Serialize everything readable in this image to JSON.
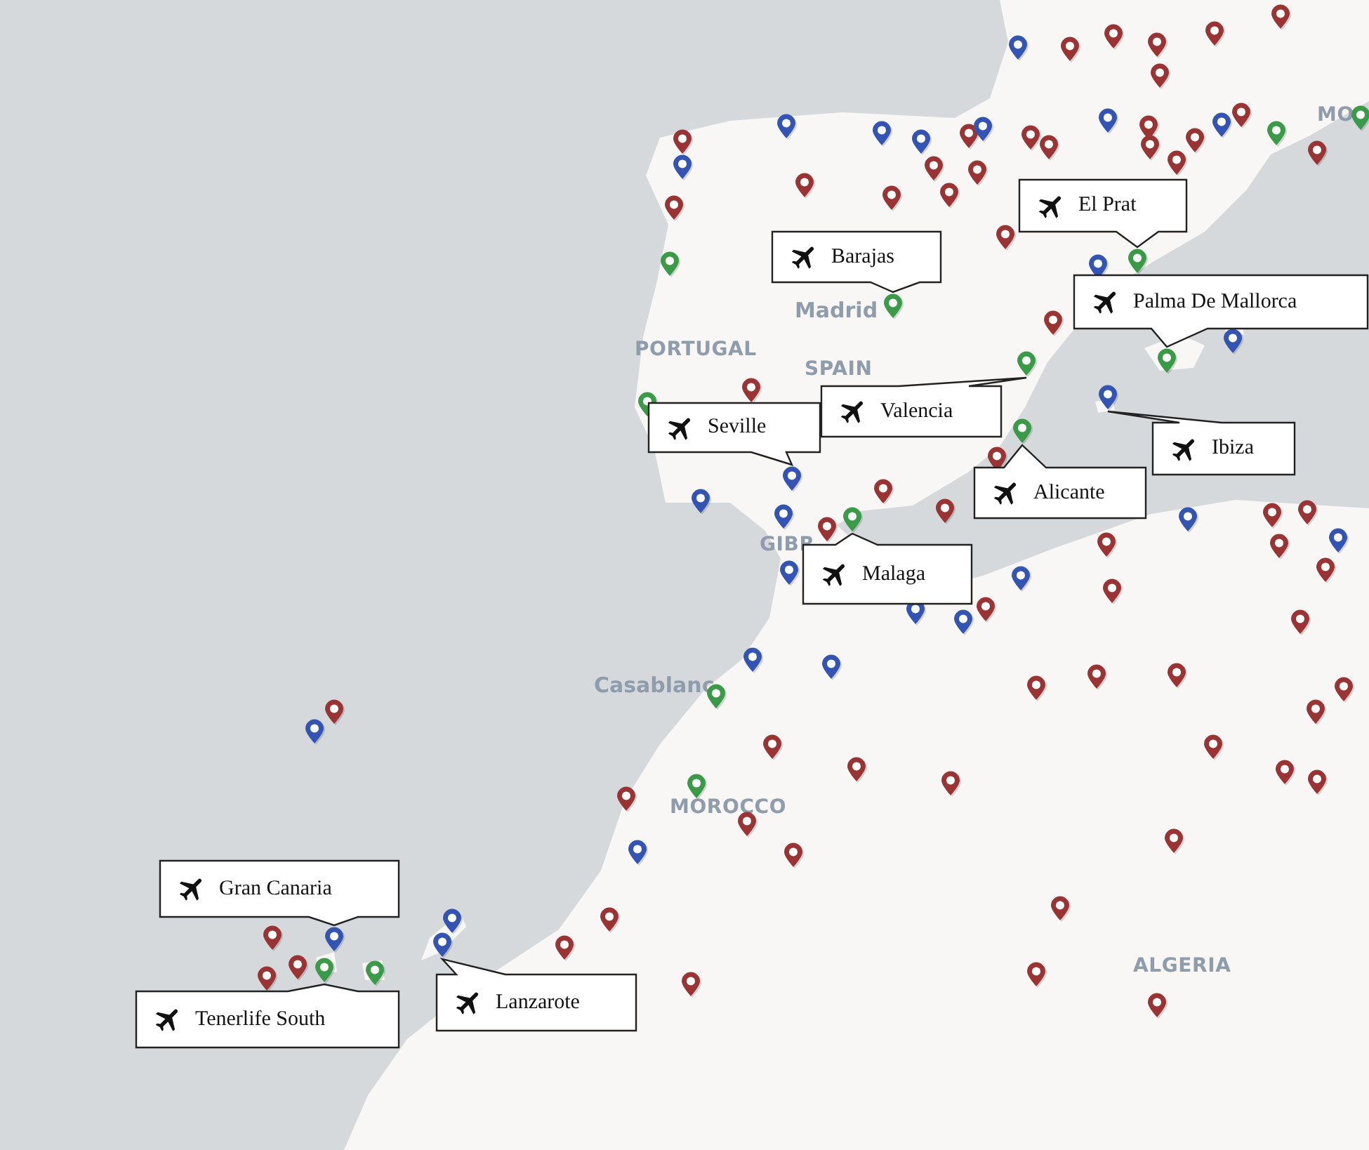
{
  "map": {
    "place_labels": [
      {
        "text": "MO",
        "kind": "country"
      },
      {
        "text": "Madrid",
        "kind": "city"
      },
      {
        "text": "PORTUGAL",
        "kind": "country"
      },
      {
        "text": "SPAIN",
        "kind": "country"
      },
      {
        "text": "GIBR",
        "kind": "country"
      },
      {
        "text": "Casablanc",
        "kind": "city"
      },
      {
        "text": "MOROCCO",
        "kind": "country"
      },
      {
        "text": "ALGERIA",
        "kind": "country"
      }
    ],
    "pins": [
      {
        "color": "#3454b4"
      },
      {
        "color": "#9a3434"
      },
      {
        "color": "#9a3434"
      },
      {
        "color": "#9a3434"
      },
      {
        "color": "#9a3434"
      },
      {
        "color": "#9a3434"
      },
      {
        "color": "#9a3434"
      },
      {
        "color": "#3454b4"
      },
      {
        "color": "#3454b4"
      },
      {
        "color": "#3454b4"
      },
      {
        "color": "#9a3434"
      },
      {
        "color": "#3454b4"
      },
      {
        "color": "#9a3434"
      },
      {
        "color": "#9a3434"
      },
      {
        "color": "#3454b4"
      },
      {
        "color": "#9a3434"
      },
      {
        "color": "#9a3434"
      },
      {
        "color": "#9a3434"
      },
      {
        "color": "#3454b4"
      },
      {
        "color": "#9a3434"
      },
      {
        "color": "#3a9a48"
      },
      {
        "color": "#3a9a48"
      },
      {
        "color": "#9a3434"
      },
      {
        "color": "#9a3434"
      },
      {
        "color": "#3454b4"
      },
      {
        "color": "#9a3434"
      },
      {
        "color": "#9a3434"
      },
      {
        "color": "#9a3434"
      },
      {
        "color": "#9a3434"
      },
      {
        "color": "#9a3434"
      },
      {
        "color": "#9a3434"
      },
      {
        "color": "#9a3434"
      },
      {
        "color": "#9a3434"
      },
      {
        "color": "#3454b4"
      },
      {
        "color": "#3a9a48"
      },
      {
        "color": "#3a9a48"
      },
      {
        "color": "#3a9a48"
      },
      {
        "color": "#9a3434"
      },
      {
        "color": "#3454b4"
      },
      {
        "color": "#3a9a48"
      },
      {
        "color": "#3a9a48"
      },
      {
        "color": "#3a9a48"
      },
      {
        "color": "#9a3434"
      },
      {
        "color": "#3454b4"
      },
      {
        "color": "#3a9a48"
      },
      {
        "color": "#9a3434"
      },
      {
        "color": "#3454b4"
      },
      {
        "color": "#3454b4"
      },
      {
        "color": "#9a3434"
      },
      {
        "color": "#3454b4"
      },
      {
        "color": "#3a9a48"
      },
      {
        "color": "#9a3434"
      },
      {
        "color": "#3454b4"
      },
      {
        "color": "#9a3434"
      },
      {
        "color": "#9a3434"
      },
      {
        "color": "#3454b4"
      },
      {
        "color": "#9a3434"
      },
      {
        "color": "#9a3434"
      },
      {
        "color": "#9a3434"
      },
      {
        "color": "#3454b4"
      },
      {
        "color": "#9a3434"
      },
      {
        "color": "#3454b4"
      },
      {
        "color": "#9a3434"
      },
      {
        "color": "#9a3434"
      },
      {
        "color": "#3454b4"
      },
      {
        "color": "#3454b4"
      },
      {
        "color": "#9a3434"
      },
      {
        "color": "#3454b4"
      },
      {
        "color": "#3454b4"
      },
      {
        "color": "#3a9a48"
      },
      {
        "color": "#9a3434"
      },
      {
        "color": "#9a3434"
      },
      {
        "color": "#3a9a48"
      },
      {
        "color": "#9a3434"
      },
      {
        "color": "#9a3434"
      },
      {
        "color": "#3454b4"
      },
      {
        "color": "#9a3434"
      },
      {
        "color": "#9a3434"
      },
      {
        "color": "#9a3434"
      },
      {
        "color": "#9a3434"
      },
      {
        "color": "#9a3434"
      },
      {
        "color": "#9a3434"
      },
      {
        "color": "#9a3434"
      },
      {
        "color": "#9a3434"
      },
      {
        "color": "#9a3434"
      },
      {
        "color": "#9a3434"
      },
      {
        "color": "#9a3434"
      },
      {
        "color": "#9a3434"
      },
      {
        "color": "#9a3434"
      },
      {
        "color": "#9a3434"
      },
      {
        "color": "#9a3434"
      },
      {
        "color": "#9a3434"
      },
      {
        "color": "#9a3434"
      },
      {
        "color": "#9a3434"
      },
      {
        "color": "#3454b4"
      },
      {
        "color": "#9a3434"
      },
      {
        "color": "#3454b4"
      },
      {
        "color": "#9a3434"
      },
      {
        "color": "#9a3434"
      },
      {
        "color": "#3a9a48"
      },
      {
        "color": "#3a9a48"
      },
      {
        "color": "#3454b4"
      },
      {
        "color": "#3454b4"
      }
    ],
    "airport_callouts": [
      {
        "label": "El Prat"
      },
      {
        "label": "Barajas"
      },
      {
        "label": "Palma De Mallorca"
      },
      {
        "label": "Valencia"
      },
      {
        "label": "Seville"
      },
      {
        "label": "Ibiza"
      },
      {
        "label": "Alicante"
      },
      {
        "label": "Malaga"
      },
      {
        "label": "Gran Canaria"
      },
      {
        "label": "Tenerlife South"
      },
      {
        "label": "Lanzarote"
      }
    ]
  }
}
